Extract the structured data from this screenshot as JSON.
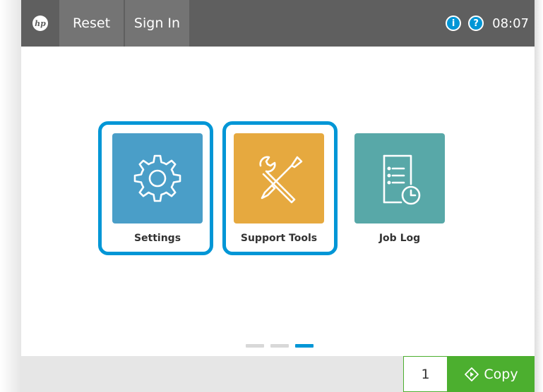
{
  "topbar": {
    "logo_text": "hp",
    "reset_label": "Reset",
    "signin_label": "Sign In",
    "info_glyph": "i",
    "help_glyph": "?",
    "time": "08:07"
  },
  "tiles": [
    {
      "label": "Settings",
      "icon": "gear-icon",
      "color": "#4a9ec8",
      "selected": true
    },
    {
      "label": "Support Tools",
      "icon": "tools-icon",
      "color": "#e6a93f",
      "selected": true
    },
    {
      "label": "Job Log",
      "icon": "job-log-icon",
      "color": "#58a8a8",
      "selected": false
    }
  ],
  "pager": {
    "pages": 3,
    "current": 3
  },
  "bottombar": {
    "copies": "1",
    "copy_label": "Copy"
  },
  "colors": {
    "accent": "#0096d6",
    "copy_green": "#4caf2f",
    "topbar": "#5f5f5f"
  }
}
